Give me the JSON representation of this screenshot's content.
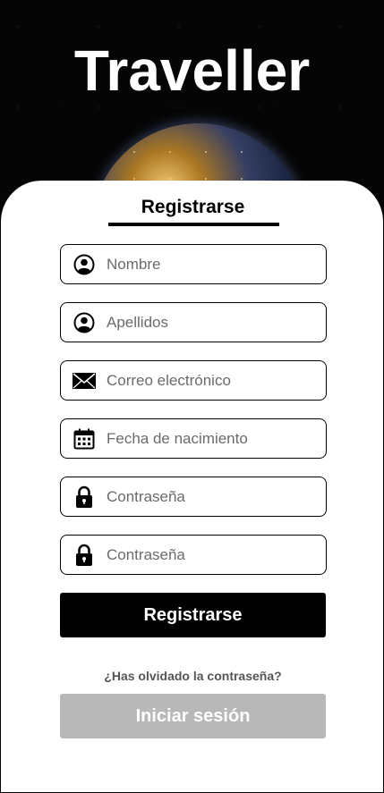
{
  "app": {
    "title": "Traveller"
  },
  "tabs": {
    "active_label": "Registrarse"
  },
  "form": {
    "fields": [
      {
        "icon": "user-icon",
        "placeholder": "Nombre",
        "value": ""
      },
      {
        "icon": "user-icon",
        "placeholder": "Apellidos",
        "value": ""
      },
      {
        "icon": "mail-icon",
        "placeholder": "Correo electrónico",
        "value": ""
      },
      {
        "icon": "calendar-icon",
        "placeholder": "Fecha de nacimiento",
        "value": ""
      },
      {
        "icon": "lock-icon",
        "placeholder": "Contraseña",
        "value": ""
      },
      {
        "icon": "lock-icon",
        "placeholder": "Contraseña",
        "value": ""
      }
    ],
    "submit_label": "Registrarse",
    "forgot_label": "¿Has olvidado la contraseña?",
    "login_label": "Iniciar sesión"
  },
  "colors": {
    "primary_button": "#000000",
    "secondary_button": "#b8b8b8",
    "background": "#000000",
    "card": "#ffffff"
  }
}
